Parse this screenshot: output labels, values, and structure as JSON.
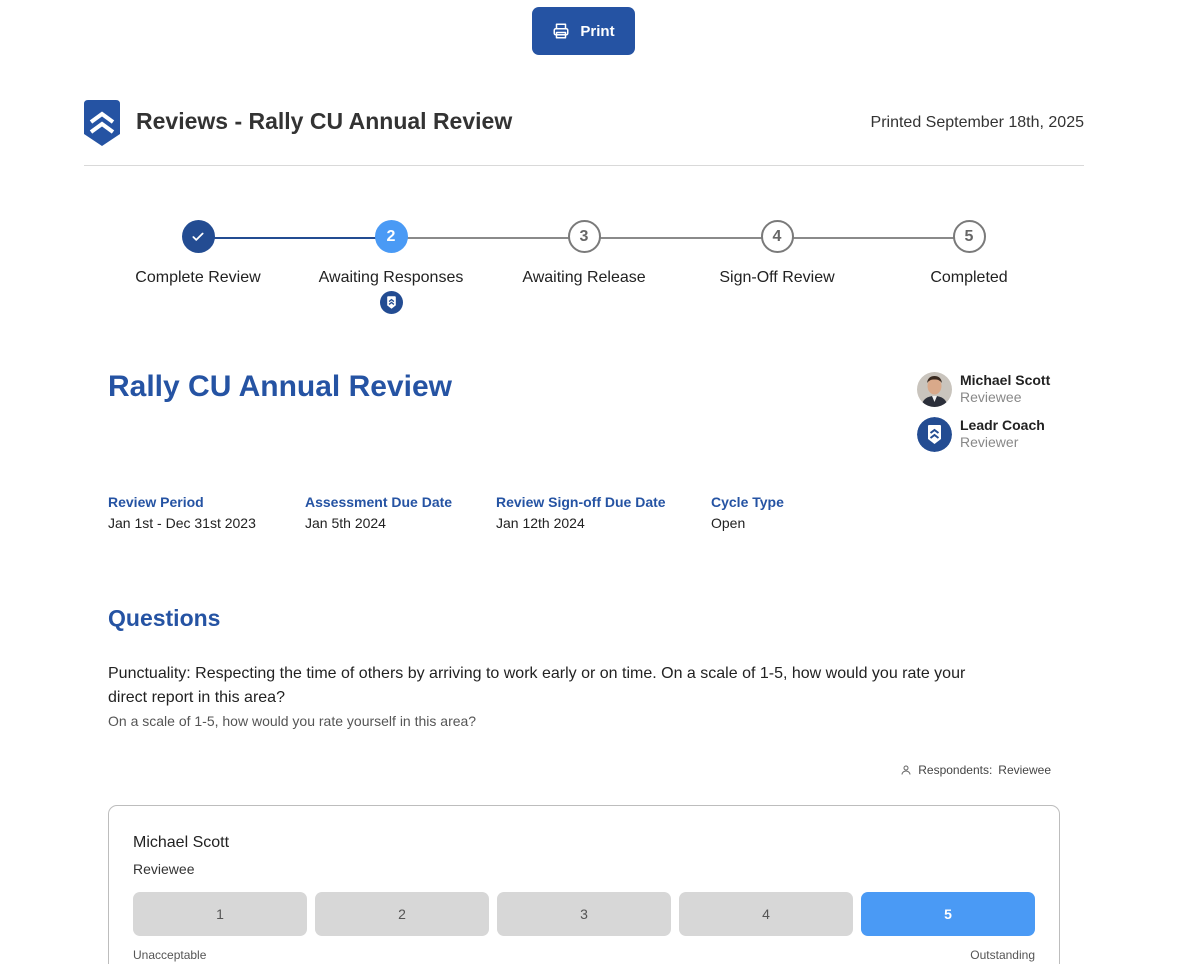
{
  "toolbar": {
    "print_label": "Print"
  },
  "header": {
    "title": "Reviews - Rally CU Annual Review",
    "printed": "Printed September 18th, 2025"
  },
  "stepper": {
    "steps": [
      {
        "number": "1",
        "label": "Complete Review",
        "state": "done"
      },
      {
        "number": "2",
        "label": "Awaiting Responses",
        "state": "active"
      },
      {
        "number": "3",
        "label": "Awaiting Release",
        "state": "pending"
      },
      {
        "number": "4",
        "label": "Sign-Off Review",
        "state": "pending"
      },
      {
        "number": "5",
        "label": "Completed",
        "state": "pending"
      }
    ]
  },
  "review": {
    "title": "Rally CU Annual Review",
    "participants": [
      {
        "name": "Michael Scott",
        "role": "Reviewee"
      },
      {
        "name": "Leadr Coach",
        "role": "Reviewer"
      }
    ],
    "meta": [
      {
        "label": "Review Period",
        "value": "Jan 1st - Dec 31st 2023"
      },
      {
        "label": "Assessment Due Date",
        "value": "Jan 5th 2024"
      },
      {
        "label": "Review Sign-off Due Date",
        "value": "Jan 12th 2024"
      },
      {
        "label": "Cycle Type",
        "value": "Open"
      }
    ]
  },
  "questions": {
    "title": "Questions",
    "items": [
      {
        "text": "Punctuality: Respecting the time of others by arriving to work early or on time. On a scale of 1-5, how would you rate your direct report in this area?",
        "subtext": "On a scale of 1-5, how would you rate yourself in this area?",
        "respondents_label": "Respondents:",
        "respondents_value": "Reviewee",
        "response": {
          "name": "Michael Scott",
          "role": "Reviewee",
          "options": [
            "1",
            "2",
            "3",
            "4",
            "5"
          ],
          "selected": "5",
          "low_label": "Unacceptable",
          "high_label": "Outstanding"
        }
      }
    ]
  },
  "colors": {
    "brand": "#2553a3",
    "active": "#4a9af5",
    "done": "#234c92"
  }
}
